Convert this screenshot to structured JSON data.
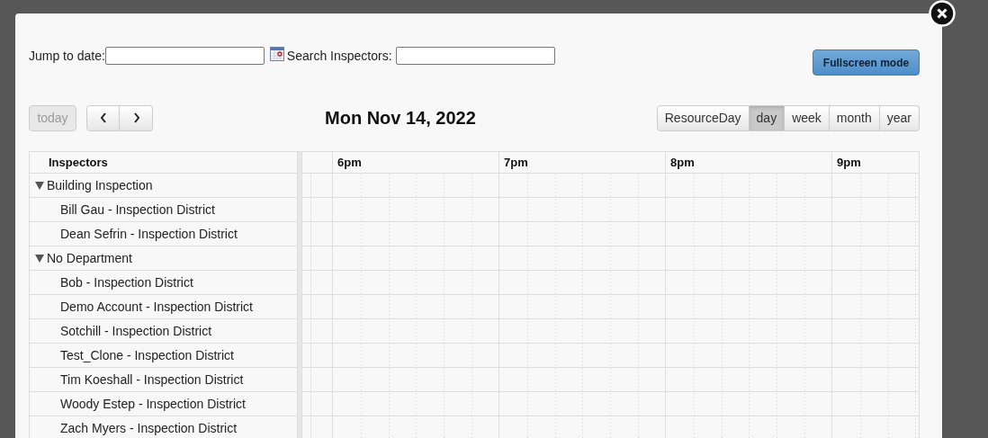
{
  "toolbar": {
    "jump_label": "Jump to date:",
    "search_label": "Search Inspectors:",
    "fullscreen": "Fullscreen mode"
  },
  "nav": {
    "today": {
      "label": "today",
      "disabled": true
    }
  },
  "title": "Mon Nov 14, 2022",
  "views": [
    {
      "label": "ResourceDay",
      "selected": false
    },
    {
      "label": "day",
      "selected": true
    },
    {
      "label": "week",
      "selected": false
    },
    {
      "label": "month",
      "selected": false
    },
    {
      "label": "year",
      "selected": false
    }
  ],
  "grid": {
    "resource_header": "Inspectors",
    "hours": [
      "6pm",
      "7pm",
      "8pm",
      "9pm"
    ],
    "groups": [
      {
        "label": "Building Inspection",
        "expanded": true,
        "children": [
          {
            "label": "Bill Gau - Inspection District"
          },
          {
            "label": "Dean Sefrin - Inspection District"
          }
        ]
      },
      {
        "label": "No Department",
        "expanded": true,
        "children": [
          {
            "label": "Bob - Inspection District"
          },
          {
            "label": "Demo Account - Inspection District"
          },
          {
            "label": "Sotchill - Inspection District"
          },
          {
            "label": "Test_Clone - Inspection District"
          },
          {
            "label": "Tim Koeshall - Inspection District"
          },
          {
            "label": "Woody Estep - Inspection District"
          },
          {
            "label": "Zach Myers - Inspection District"
          }
        ]
      }
    ]
  }
}
